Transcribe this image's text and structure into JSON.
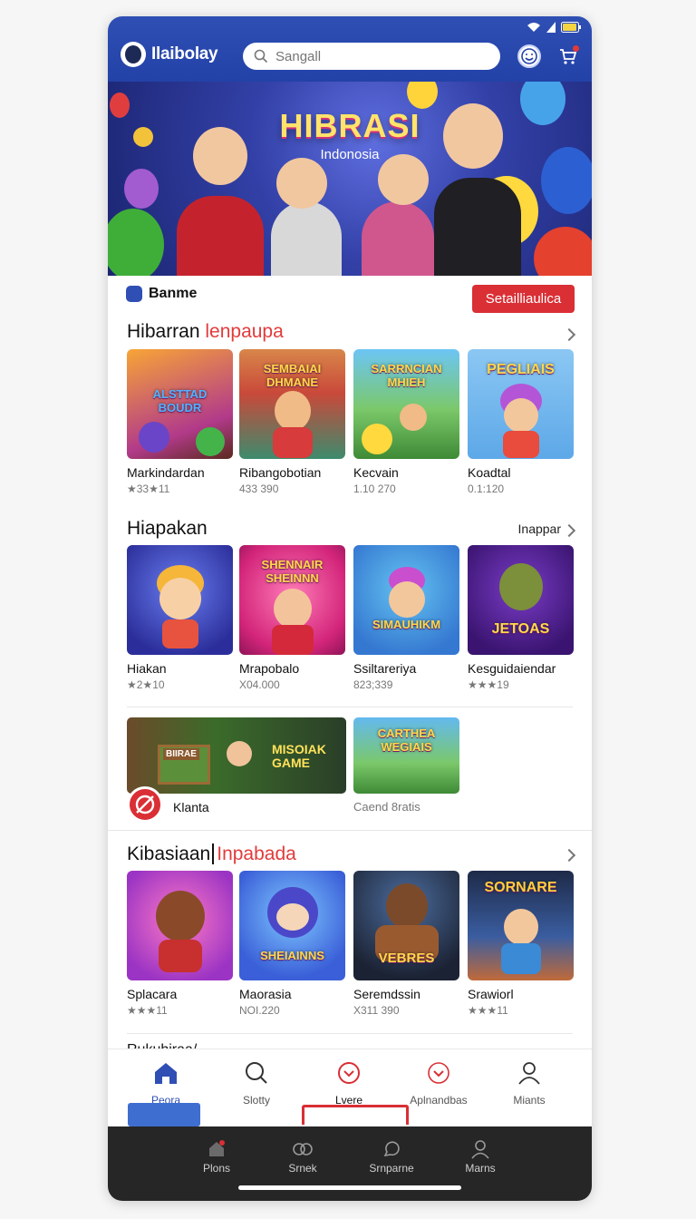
{
  "header": {
    "app_name": "Ilaibolay",
    "search_placeholder": "Sangall"
  },
  "hero": {
    "title": "HIBRASI",
    "subtitle": "Indonosia"
  },
  "brand": {
    "label": "Banme",
    "cta_label": "Setailliaulica"
  },
  "section1": {
    "title_main": "Hibarran ",
    "title_accent": "lenpaupa",
    "items": [
      {
        "title": "Markindardan",
        "meta": "★33★11",
        "badge": "ALSTTAD BOUDR"
      },
      {
        "title": "Ribangobotian",
        "meta": "433 390",
        "badge": "SEMBAIAI DHMANE"
      },
      {
        "title": "Kecvain",
        "meta": "1.10 270",
        "badge": "SARRNCIAN MHIEH"
      },
      {
        "title": "Koadtal",
        "meta": "0.1:120",
        "badge": "PEGLIAIS"
      }
    ]
  },
  "section2": {
    "title": "Hiapakan",
    "more_label": "Inappar",
    "items": [
      {
        "title": "Hiakan",
        "meta": "★2★10",
        "badge": ""
      },
      {
        "title": "Mrapobalo",
        "meta": "X04.000",
        "badge": "SHENNAIR SHEINNN"
      },
      {
        "title": "Ssiltareriya",
        "meta": "823;339",
        "badge": "SIMAUHIKM"
      },
      {
        "title": "Kesguidaiendar",
        "meta": "★★★19",
        "badge": "JETOAS"
      }
    ],
    "wide_card": {
      "label": "Klanta",
      "headline": "MISOIAK GAME",
      "sign": "BIIRAE"
    },
    "small_card": {
      "label": "Caend 8ratis",
      "badge": "CARTHEA WEGIAIS"
    }
  },
  "section3": {
    "title_main": "Kibasiaan",
    "title_accent": "Inpabada",
    "items": [
      {
        "title": "Splacara",
        "meta": "★★★11",
        "badge": ""
      },
      {
        "title": "Maorasia",
        "meta": "NOI.220",
        "badge": "SHEIAINNS"
      },
      {
        "title": "Seremdssin",
        "meta": "X311 390",
        "badge": "VEBRES"
      },
      {
        "title": "Srawiorl",
        "meta": "★★★11",
        "badge": "SORNARE"
      }
    ]
  },
  "peek_heading": "Rukuhiraa/",
  "bottom_nav": [
    {
      "label": "Peora",
      "icon": "home-icon"
    },
    {
      "label": "Slotty",
      "icon": "search-icon"
    },
    {
      "label": "Lvere",
      "icon": "chevron-circle-icon"
    },
    {
      "label": "Aplnandbas",
      "icon": "heart-chevron-icon"
    },
    {
      "label": "Miants",
      "icon": "person-icon"
    }
  ],
  "system_nav": [
    {
      "label": "Plons",
      "icon": "home-outline-icon"
    },
    {
      "label": "Srnek",
      "icon": "gamepad-icon"
    },
    {
      "label": "Srnparne",
      "icon": "chat-icon"
    },
    {
      "label": "Marns",
      "icon": "person-icon"
    }
  ],
  "colors": {
    "header": "#2342a8",
    "accent_red": "#d92f35",
    "active_nav": "#2f4fb4"
  }
}
